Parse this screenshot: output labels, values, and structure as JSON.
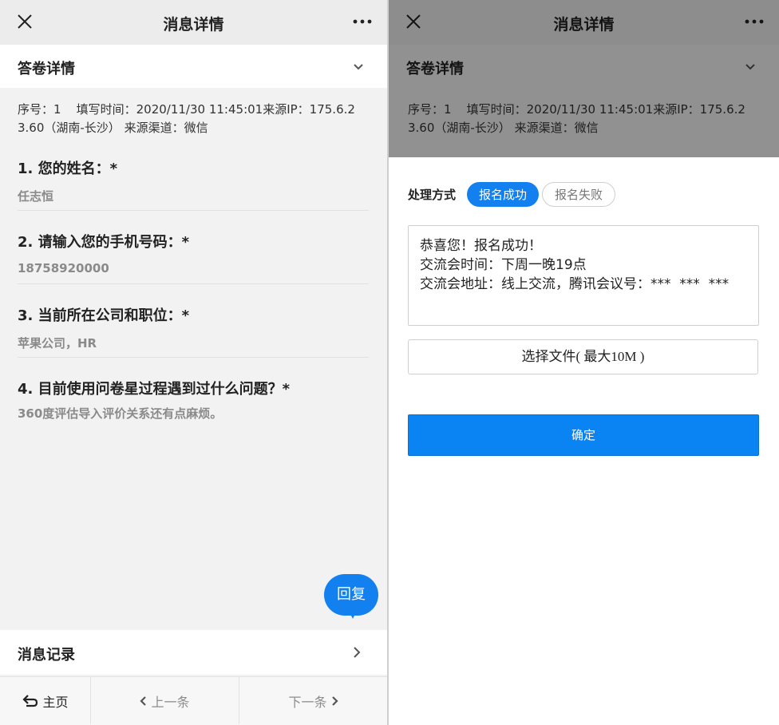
{
  "colors": {
    "accent": "#1380f0",
    "background": "#f2f2f2",
    "muted_text": "#8a8a8a"
  },
  "left": {
    "navbar": {
      "title": "消息详情",
      "close_icon": "close-icon",
      "more_icon": "more-icon"
    },
    "section": {
      "label": "答卷详情",
      "icon": "chevron-down-icon"
    },
    "meta": {
      "line1": "序号：1    填写时间：2020/11/30 11:45:01来源IP：175.6.2",
      "line2": "3.60（湖南-长沙） 来源渠道：微信"
    },
    "questions": [
      {
        "title": "1. 您的姓名：*",
        "answer": "任志恒"
      },
      {
        "title": "2. 请输入您的手机号码：*",
        "answer": "18758920000"
      },
      {
        "title": "3. 当前所在公司和职位：*",
        "answer": "苹果公司，HR"
      },
      {
        "title": "4. 目前使用问卷星过程遇到过什么问题？*",
        "answer": "360度评估导入评价关系还有点麻烦。"
      }
    ],
    "reply_label": "回复",
    "message_record": {
      "label": "消息记录",
      "icon": "chevron-right-icon"
    },
    "bottom_nav": {
      "home": "主页",
      "prev": "上一条",
      "next": "下一条"
    }
  },
  "right": {
    "navbar": {
      "title": "消息详情",
      "close_icon": "close-icon",
      "more_icon": "more-icon"
    },
    "section": {
      "label": "答卷详情",
      "icon": "chevron-down-icon"
    },
    "meta": {
      "line1": "序号：1    填写时间：2020/11/30 11:45:01来源IP：175.6.2",
      "line2": "3.60（湖南-长沙） 来源渠道：微信"
    },
    "process": {
      "label": "处理方式",
      "options": [
        "报名成功",
        "报名失败"
      ],
      "selected": "报名成功"
    },
    "reply_text": {
      "line1": "恭喜您！报名成功！",
      "line2": "交流会时间：下周一晚19点",
      "line3": "交流会地址：线上交流，腾讯会议号：***  ***  ***"
    },
    "file_button": "选择文件( 最大10M )",
    "confirm_button": "确定"
  }
}
